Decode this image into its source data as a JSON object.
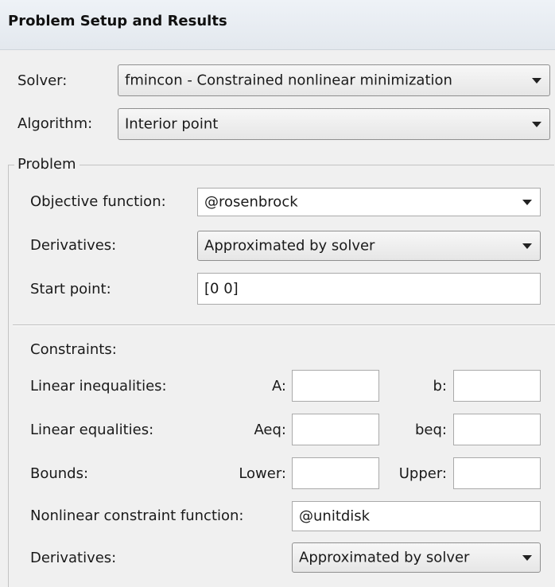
{
  "header": {
    "title": "Problem Setup and Results"
  },
  "solver": {
    "label": "Solver:",
    "value": "fmincon - Constrained nonlinear minimization"
  },
  "algorithm": {
    "label": "Algorithm:",
    "value": "Interior point"
  },
  "problem": {
    "group_label": "Problem",
    "objective": {
      "label": "Objective function:",
      "value": "@rosenbrock"
    },
    "derivatives": {
      "label": "Derivatives:",
      "value": "Approximated by solver"
    },
    "start_point": {
      "label": "Start point:",
      "value": "[0 0]"
    }
  },
  "constraints": {
    "heading": "Constraints:",
    "linear_inequalities": {
      "label": "Linear inequalities:",
      "a_label": "A:",
      "b_label": "b:",
      "a_value": "",
      "b_value": ""
    },
    "linear_equalities": {
      "label": "Linear equalities:",
      "aeq_label": "Aeq:",
      "beq_label": "beq:",
      "aeq_value": "",
      "beq_value": ""
    },
    "bounds": {
      "label": "Bounds:",
      "lower_label": "Lower:",
      "upper_label": "Upper:",
      "lower_value": "",
      "upper_value": ""
    },
    "nonlinear": {
      "label": "Nonlinear constraint function:",
      "value": "@unitdisk"
    },
    "derivatives": {
      "label": "Derivatives:",
      "value": "Approximated by solver"
    }
  }
}
